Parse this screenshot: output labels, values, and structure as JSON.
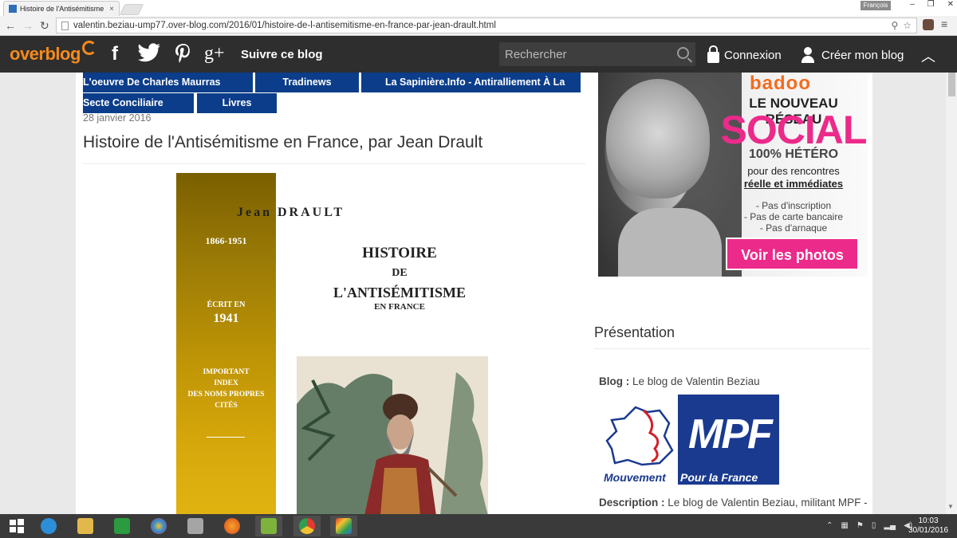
{
  "browser": {
    "tab_title": "Histoire de l'Antisémitisme en France",
    "tab_close": "×",
    "language_badge": "François",
    "url": "valentin.beziau-ump77.over-blog.com/2016/01/histoire-de-l-antisemitisme-en-france-par-jean-drault.html"
  },
  "overblog": {
    "logo_text": "overblog",
    "follow_label": "Suivre ce blog",
    "search_placeholder": "Rechercher",
    "login_label": "Connexion",
    "create_label": "Créer mon blog"
  },
  "menu": {
    "items": [
      {
        "label": "L'oeuvre De Charles Maurras"
      },
      {
        "label": "Tradinews"
      },
      {
        "label": "La Sapinière.Info - Antiralliement À La"
      },
      {
        "label": "Secte Conciliaire"
      },
      {
        "label": "Livres"
      }
    ]
  },
  "post": {
    "date": "28 janvier 2016",
    "title": "Histoire de l'Antisémitisme en France, par Jean Drault",
    "cover": {
      "author": "Jean DRAULT",
      "years": "1866-1951",
      "written_in": "ÉCRIT EN",
      "year": "1941",
      "important": "IMPORTANT",
      "index": "INDEX",
      "names": "DES NOMS PROPRES",
      "cited": "CITÉS",
      "title_line1": "HISTOIRE",
      "title_line2": "DE",
      "title_line3": "L'ANTISÉMITISME",
      "title_line4": "EN FRANCE"
    }
  },
  "ad": {
    "brand": "badoo",
    "nouveau": "LE NOUVEAU RÉSEAU",
    "social": "SOCIAL",
    "hetero": "100% HÉTÉRO",
    "line1": "pour des rencontres",
    "line2": "réelle et immédiates",
    "bullet1": "- Pas d'inscription",
    "bullet2": "- Pas de carte bancaire",
    "bullet3": "- Pas d'arnaque",
    "cta": "Voir les photos"
  },
  "sidebar": {
    "presentation_title": "Présentation",
    "blog_label": "Blog :",
    "blog_value": "Le blog de Valentin Beziau",
    "logo_mpf": "MPF",
    "logo_mouvement": "Mouvement",
    "logo_pour": "Pour la France",
    "description_label": "Description :",
    "description_value": "Le blog de Valentin Beziau, militant MPF - Mouvement Pour la France"
  },
  "taskbar": {
    "time": "10:03",
    "date": "30/01/2016"
  },
  "colors": {
    "menu_blue": "#0b3d8a",
    "overblog_orange": "#f48a1e",
    "ad_pink": "#ec2a8a"
  }
}
